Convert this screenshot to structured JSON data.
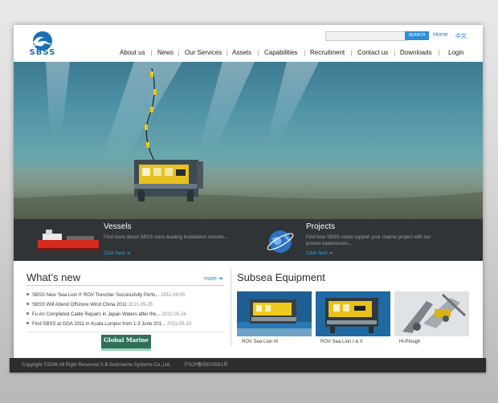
{
  "logo": {
    "text": "SBSS"
  },
  "header": {
    "search_button": "SEARCH",
    "home_link": "Home",
    "lang_link": "中文"
  },
  "nav": {
    "items": [
      "About us",
      "News",
      "Our Services",
      "Assets",
      "Capabilities",
      "Recruitment",
      "Contact us",
      "Downloads",
      "Login"
    ]
  },
  "features": [
    {
      "title": "Vessels",
      "description": "Find more about SBSS class-leading installation vessels...",
      "link": "Click here ➔"
    },
    {
      "title": "Projects",
      "description": "Find how SBSS could support your marine project with our proven experiences...",
      "link": "Click here ➔"
    }
  ],
  "news": {
    "title": "What’s  new",
    "more": "more ➔",
    "items": [
      {
        "text": "SBSS New 'Sea Lion II' ROV Trencher Successfully Perfo...",
        "date": "2011-09-05"
      },
      {
        "text": "SBSS Will Attend Offshore Wind China 2011",
        "date": "2011-05-25"
      },
      {
        "text": "Fu An Completed Cable Repairs in Japan Waters after the...",
        "date": "2011-05-24"
      },
      {
        "text": "Find SBSS at OGA 2011 in Kuala Lumpur from 1-3 June 201...",
        "date": "2011-05-23"
      }
    ],
    "partner_logo": "Global Marine"
  },
  "subsea": {
    "title": "Subsea Equipment",
    "items": [
      {
        "label": "ROV Sea Lion III"
      },
      {
        "label": "ROV Sea Lion I & II"
      },
      {
        "label": "Hi-Plough"
      }
    ]
  },
  "footer": {
    "copyright": "Copyright ©2006 All Right Reserved S.B.Submarine Systems Co.,Ltd.",
    "icp": "沪ICP备05010581号"
  },
  "colors": {
    "accent": "#1f7ec7",
    "strip": "#303436",
    "footer": "#2b2d2e"
  }
}
